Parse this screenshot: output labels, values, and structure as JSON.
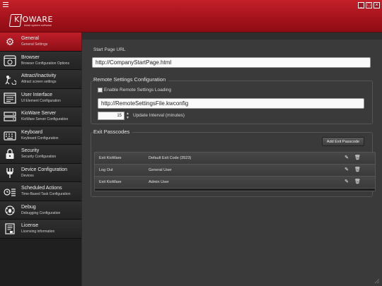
{
  "app": {
    "brand": "KIOWARE",
    "tagline": "kiosk system software",
    "window_controls": [
      "_",
      "□",
      "×"
    ]
  },
  "sidebar": {
    "items": [
      {
        "title": "General",
        "subtitle": "General Settings",
        "icon": "gear-icon",
        "active": true
      },
      {
        "title": "Browser",
        "subtitle": "Browser Configuration Options",
        "icon": "browser-icon",
        "active": false
      },
      {
        "title": "Attract/Inactivity",
        "subtitle": "Attract screen settings",
        "icon": "attract-icon",
        "active": false
      },
      {
        "title": "User Interface",
        "subtitle": "UI Element Configuration",
        "icon": "user-interface-icon",
        "active": false
      },
      {
        "title": "KioWare Server",
        "subtitle": "KioWare Server Configuration",
        "icon": "server-icon",
        "active": false
      },
      {
        "title": "Keyboard",
        "subtitle": "Keyboard Configuration",
        "icon": "keyboard-icon",
        "active": false
      },
      {
        "title": "Security",
        "subtitle": "Security Configuration",
        "icon": "lock-icon",
        "active": false
      },
      {
        "title": "Device Configuration",
        "subtitle": "Devices",
        "icon": "devices-icon",
        "active": false
      },
      {
        "title": "Scheduled Actions",
        "subtitle": "Time-Based Task Configuration",
        "icon": "clock-icon",
        "active": false
      },
      {
        "title": "Debug",
        "subtitle": "Debugging Configuration",
        "icon": "debug-icon",
        "active": false
      },
      {
        "title": "License",
        "subtitle": "Licensing information",
        "icon": "license-icon",
        "active": false
      }
    ]
  },
  "general": {
    "start_page_label": "Start Page URL",
    "start_page_value": "http://CompanyStartPage.html",
    "remote": {
      "title": "Remote Settings Configuration",
      "enable_label": "Enable Remote Settings Loading",
      "enable_checked": false,
      "url_value": "http://RemoteSettingsFile.kwconfig",
      "interval_value": "15",
      "interval_label": "Update Interval (minutes)"
    },
    "exit": {
      "title": "Exit Passcodes",
      "add_button": "Add Exit Passcode",
      "rows": [
        {
          "action": "Exit KioWare",
          "name": "Default Exit Code (3523)"
        },
        {
          "action": "Log Out",
          "name": "General User"
        },
        {
          "action": "Exit KioWare",
          "name": "Admin User"
        }
      ]
    }
  }
}
